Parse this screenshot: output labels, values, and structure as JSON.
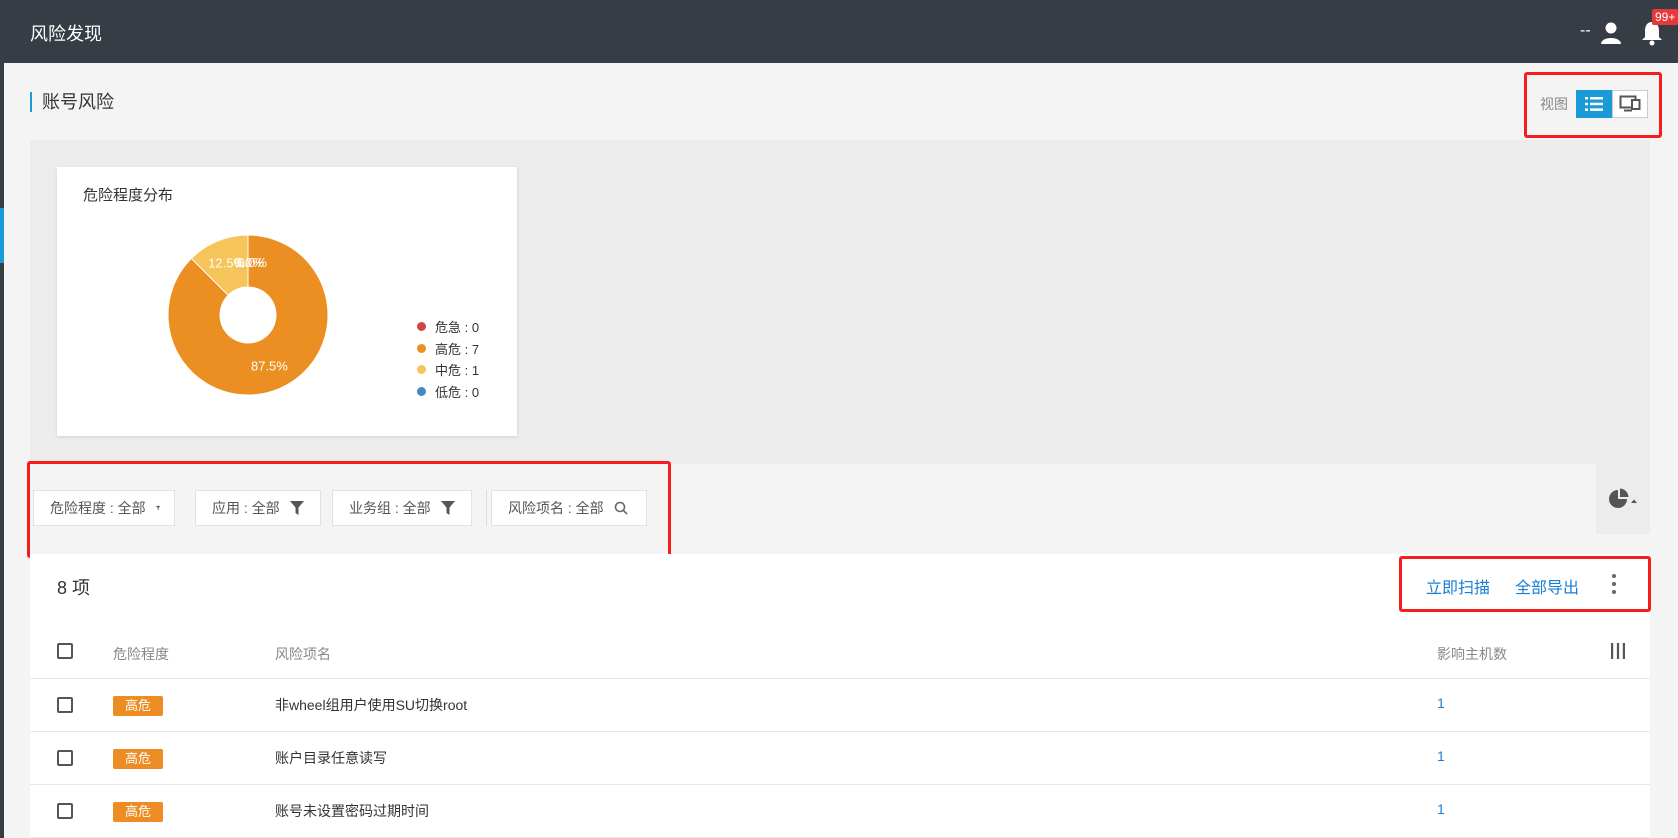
{
  "header": {
    "title": "风险发现",
    "user": "--",
    "badge": "99+"
  },
  "page": {
    "title": "账号风险"
  },
  "view_toggle": {
    "label": "视图"
  },
  "chart_data": {
    "type": "pie",
    "title": "危险程度分布",
    "labels": [
      "危急",
      "高危",
      "中危",
      "低危"
    ],
    "values": [
      0,
      7,
      1,
      0
    ],
    "percent_labels": [
      "0.0%",
      "87.5%",
      "12.5%",
      "0.0%"
    ],
    "legend": [
      "危急 : 0",
      "高危 : 7",
      "中危 : 1",
      "低危 : 0"
    ],
    "colors": [
      "#d0463e",
      "#ec8f23",
      "#f5c45a",
      "#4a86c5"
    ],
    "donut": true
  },
  "filters": [
    "危险程度 : 全部",
    "应用 : 全部",
    "业务组 : 全部",
    "风险项名 : 全部"
  ],
  "table": {
    "count": "8 项",
    "actions": {
      "scan": "立即扫描",
      "export": "全部导出"
    },
    "headers": {
      "level": "危险程度",
      "name": "风险项名",
      "hosts": "影响主机数"
    },
    "rows": [
      {
        "level": "高危",
        "name": "非wheel组用户使用SU切换root",
        "hosts": "1"
      },
      {
        "level": "高危",
        "name": "账户目录任意读写",
        "hosts": "1"
      },
      {
        "level": "高危",
        "name": "账号未设置密码过期时间",
        "hosts": "1"
      }
    ]
  }
}
